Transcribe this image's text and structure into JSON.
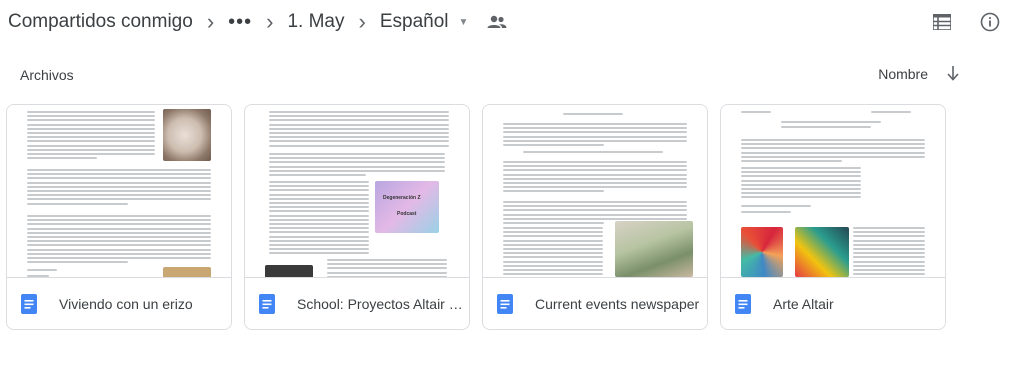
{
  "breadcrumb": {
    "items": [
      {
        "label": "Compartidos conmigo"
      },
      {
        "label": "•••"
      },
      {
        "label": "1. May"
      },
      {
        "label": "Español"
      }
    ],
    "separator": "›",
    "dropdown_caret": "▼"
  },
  "toolbar": {
    "list_view_icon": "list-view-icon",
    "info_icon": "info-icon",
    "shared_icon": "shared-folder-people-icon"
  },
  "section": {
    "title": "Archivos",
    "sort_label": "Nombre",
    "sort_direction_icon": "arrow-down-icon"
  },
  "files": [
    {
      "name": "Viviendo con un erizo",
      "type_icon": "google-docs-icon"
    },
    {
      "name": "School: Proyectos Altair e...",
      "type_icon": "google-docs-icon"
    },
    {
      "name": "Current events newspaper",
      "type_icon": "google-docs-icon"
    },
    {
      "name": "Arte Altair",
      "type_icon": "google-docs-icon"
    }
  ],
  "thumbnails": {
    "doc2_overlay_title": "Degeneración Z",
    "doc2_overlay_sub": "Podcast"
  },
  "colors": {
    "doc_icon_blue": "#4285f4",
    "border": "#dadce0",
    "text": "#3c4043"
  }
}
